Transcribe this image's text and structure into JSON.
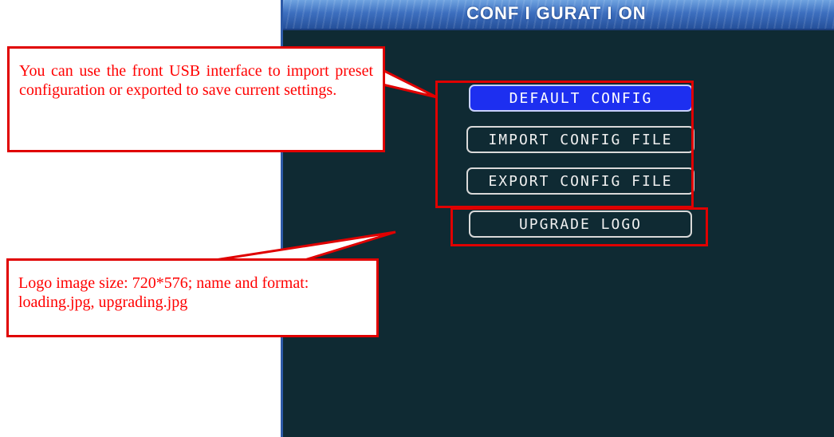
{
  "screen": {
    "title": "CONF I GURAT I ON",
    "buttons": [
      {
        "label": "DEFAULT CONFIG",
        "selected": true
      },
      {
        "label": "IMPORT CONFIG FILE",
        "selected": false
      },
      {
        "label": "EXPORT CONFIG FILE",
        "selected": false
      },
      {
        "label": "UPGRADE LOGO",
        "selected": false
      }
    ]
  },
  "annotations": {
    "usb_note": "You can use the front USB interface to import preset configuration or exported to save current settings.",
    "logo_note": "Logo image size: 720*576; name and format: loading.jpg, upgrading.jpg"
  },
  "colors": {
    "annotation": "#ff0000",
    "screen_background": "#0f2a33",
    "selected_button": "#1d2ff0"
  }
}
